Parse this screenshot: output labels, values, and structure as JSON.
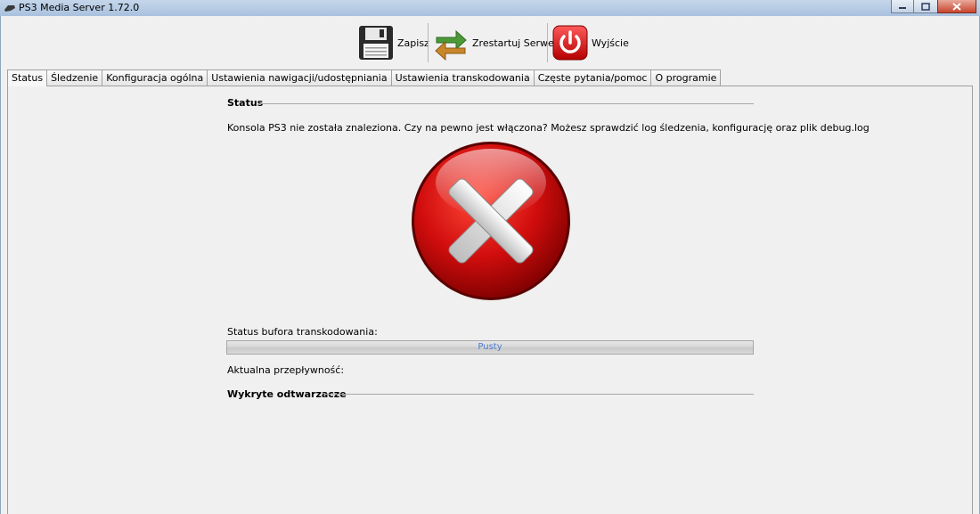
{
  "window": {
    "title": "PS3 Media Server 1.72.0"
  },
  "toolbar": {
    "save_label": "Zapisz",
    "restart_label": "Zrestartuj Serwer",
    "exit_label": "Wyjście"
  },
  "tabs": [
    {
      "label": "Status",
      "active": true
    },
    {
      "label": "Śledzenie"
    },
    {
      "label": "Konfiguracja ogólna"
    },
    {
      "label": "Ustawienia nawigacji/udostępniania"
    },
    {
      "label": "Ustawienia transkodowania"
    },
    {
      "label": "Częste pytania/pomoc"
    },
    {
      "label": "O programie"
    }
  ],
  "status": {
    "heading": "Status",
    "message": "Konsola PS3 nie została znaleziona. Czy na pewno jest włączona? Możesz sprawdzić log śledzenia, konfigurację oraz plik debug.log",
    "buffer_label": "Status bufora transkodowania:",
    "buffer_value": "Pusty",
    "buffer_progress": 0,
    "bitrate_label": "Aktualna przepływność:",
    "players_heading": "Wykryte odtwarzacze"
  },
  "icons": {
    "app": "ps3-icon",
    "save": "floppy-disk-icon",
    "restart": "restart-arrows-icon",
    "exit": "power-icon",
    "status": "error-x-icon"
  },
  "colors": {
    "error_red": "#c40a0a",
    "progress_text": "#4b7bd0"
  }
}
